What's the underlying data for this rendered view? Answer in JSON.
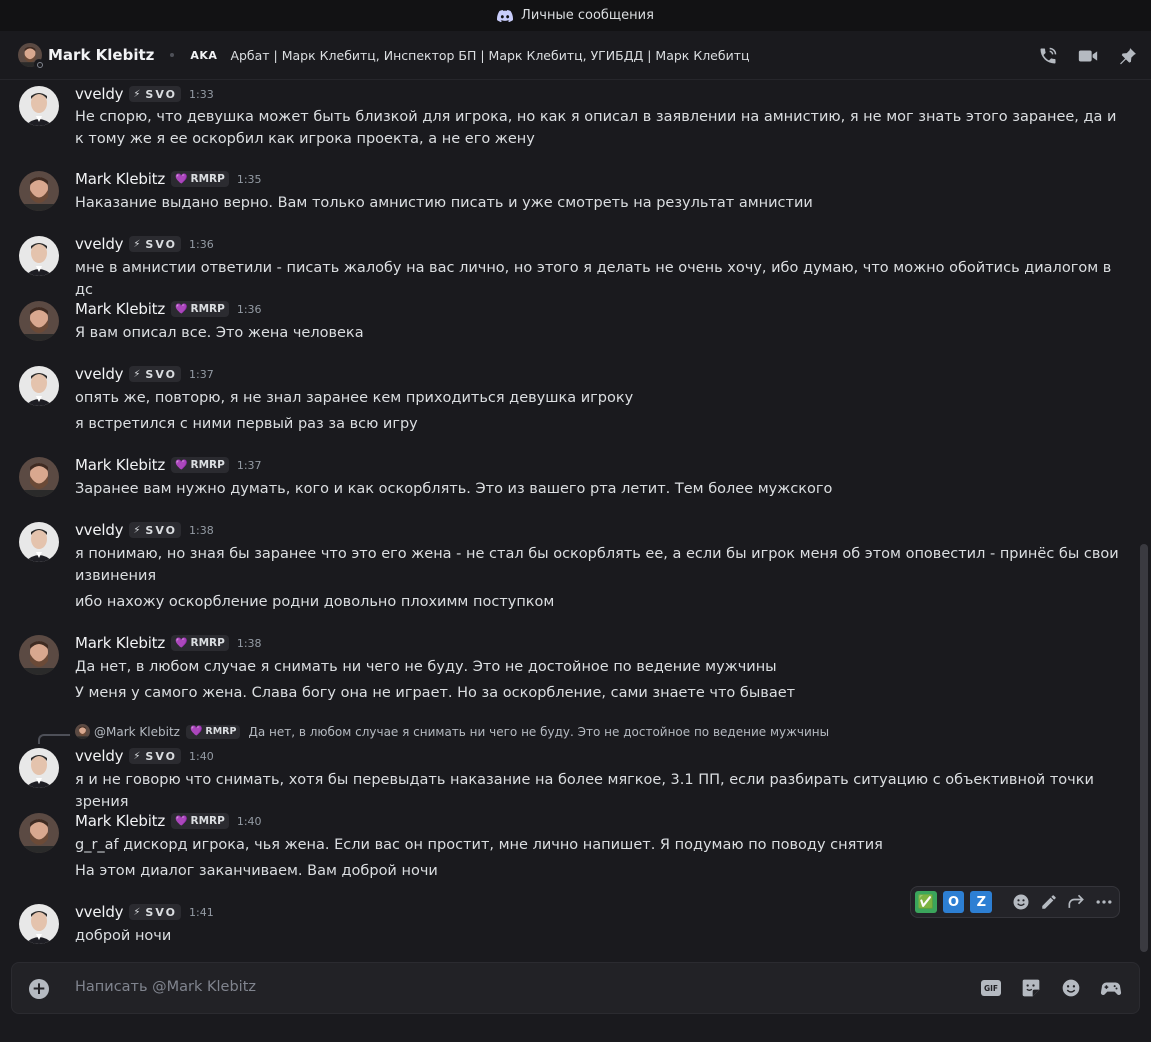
{
  "window": {
    "title": "Личные сообщения"
  },
  "header": {
    "name": "Mark Klebitz",
    "aka_label": "AKA",
    "aka_text": "Арбат | Марк Клебитц, Инспектор БП | Марк Клебитц, УГИБДД | Марк Клебитц",
    "icons": [
      "phone-call-icon",
      "video-call-icon",
      "pin-icon"
    ]
  },
  "tags": {
    "vveldy": {
      "emoji": "⚡",
      "text": "SVO"
    },
    "mark": {
      "emoji": "💜",
      "text": "RMRP"
    }
  },
  "messages": [
    {
      "author": "vveldy",
      "time": "1:33",
      "lines": [
        "Не спорю, что девушка может быть близкой для игрока, но как я описал в заявлении на амнистию, я не мог знать этого заранее, да и к тому же я ее оскорбил как игрока проекта, а не его жену"
      ]
    },
    {
      "author": "Mark Klebitz",
      "time": "1:35",
      "lines": [
        "Наказание выдано верно. Вам только амнистию писать и уже смотреть на результат амнистии"
      ]
    },
    {
      "author": "vveldy",
      "time": "1:36",
      "lines": [
        "мне в амнистии ответили - писать жалобу на вас лично, но этого я делать не очень хочу, ибо думаю, что можно обойтись диалогом в дс"
      ]
    },
    {
      "author": "Mark Klebitz",
      "time": "1:36",
      "lines": [
        "Я вам описал все. Это жена человека"
      ]
    },
    {
      "author": "vveldy",
      "time": "1:37",
      "lines": [
        "опять же, повторю, я не знал заранее кем приходиться девушка игроку",
        "я встретился с ними первый раз за всю игру"
      ]
    },
    {
      "author": "Mark Klebitz",
      "time": "1:37",
      "lines": [
        "Заранее вам нужно думать, кого и как оскорблять. Это из вашего рта летит. Тем более мужского"
      ]
    },
    {
      "author": "vveldy",
      "time": "1:38",
      "lines": [
        "я понимаю, но зная бы заранее что это его жена - не стал бы оскорблять ее, а если бы игрок меня об этом оповестил - принёс бы свои извинения",
        "ибо нахожу оскорбление родни довольно плохимм поступком"
      ]
    },
    {
      "author": "Mark Klebitz",
      "time": "1:38",
      "lines": [
        "Да нет, в любом случае я снимать ни чего не буду. Это не достойное по ведение мужчины",
        "У меня у самого жена. Слава богу она не играет. Но за оскорбление, сами знаете что бывает"
      ]
    },
    {
      "author": "vveldy",
      "time": "1:40",
      "reply": {
        "author": "@Mark Klebitz",
        "text": "Да нет, в любом случае я снимать ни чего не буду. Это не достойное по ведение мужчины"
      },
      "lines": [
        "я и не говорю что снимать, хотя бы перевыдать наказание на более мягкое, 3.1 ПП, если разбирать ситуацию с объективной точки зрения"
      ]
    },
    {
      "author": "Mark Klebitz",
      "time": "1:40",
      "lines": [
        "g_r_af дискорд игрока, чья жена. Если вас он простит, мне лично напишет. Я подумаю по поводу снятия",
        "На этом диалог заканчиваем. Вам доброй ночи"
      ]
    },
    {
      "author": "vveldy",
      "time": "1:41",
      "lines": [
        "доброй ночи"
      ]
    }
  ],
  "hover_toolbar": {
    "reactions": [
      "✅",
      "O",
      "Z"
    ],
    "icons": [
      "add-reaction-icon",
      "edit-icon",
      "forward-icon",
      "more-icon"
    ]
  },
  "composer": {
    "placeholder": "Написать @Mark Klebitz",
    "gif_label": "GIF",
    "icons": [
      "gif-icon",
      "sticker-icon",
      "emoji-icon",
      "activity-icon"
    ]
  },
  "colors": {
    "background": "#1a1a1e",
    "accent": "#5865f2",
    "text": "#dbdee1",
    "muted": "#949ba4"
  }
}
